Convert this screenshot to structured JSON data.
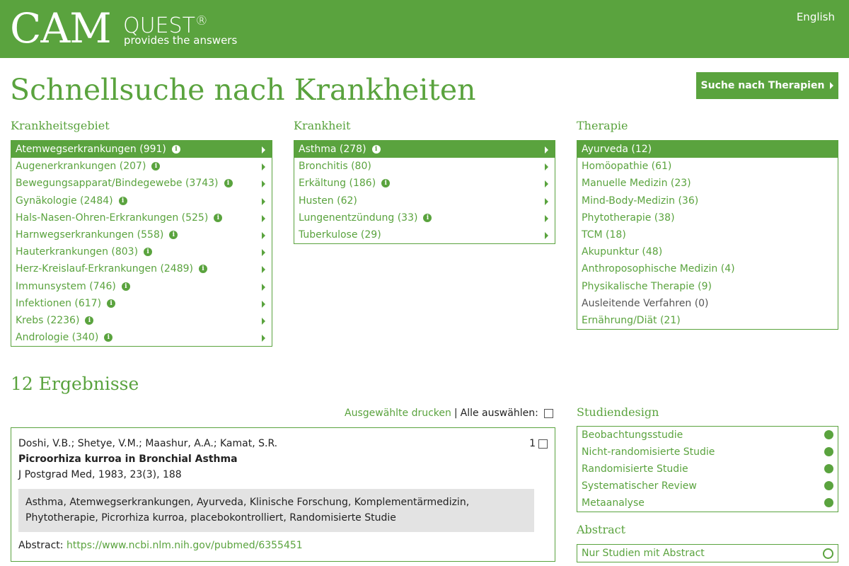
{
  "header": {
    "logo_cam": "CAM",
    "logo_quest": "QUEST",
    "logo_reg": "®",
    "tagline": "provides the answers",
    "language": "English"
  },
  "page_title": "Schnellsuche nach Krankheiten",
  "therapy_button": "Suche nach Therapien",
  "columns": {
    "krankheitsgebiet": {
      "title": "Krankheitsgebiet",
      "items": [
        {
          "label": "Atemwegserkrankungen (991)",
          "selected": true
        },
        {
          "label": "Augenerkrankungen (207)"
        },
        {
          "label": "Bewegungsapparat/Bindegewebe (3743)"
        },
        {
          "label": "Gynäkologie (2484)"
        },
        {
          "label": "Hals-Nasen-Ohren-Erkrankungen (525)"
        },
        {
          "label": "Harnwegserkrankungen (558)"
        },
        {
          "label": "Hauterkrankungen (803)"
        },
        {
          "label": "Herz-Kreislauf-Erkrankungen (2489)"
        },
        {
          "label": "Immunsystem (746)"
        },
        {
          "label": "Infektionen (617)"
        },
        {
          "label": "Krebs (2236)"
        },
        {
          "label": "Andrologie (340)"
        }
      ]
    },
    "krankheit": {
      "title": "Krankheit",
      "items": [
        {
          "label": "Asthma (278)",
          "selected": true,
          "info": true
        },
        {
          "label": "Bronchitis (80)",
          "info": false
        },
        {
          "label": "Erkältung (186)",
          "info": true
        },
        {
          "label": "Husten (62)",
          "info": false
        },
        {
          "label": "Lungenentzündung (33)",
          "info": true
        },
        {
          "label": "Tuberkulose (29)",
          "info": false
        }
      ]
    },
    "therapie": {
      "title": "Therapie",
      "items": [
        {
          "label": "Ayurveda (12)",
          "selected": true
        },
        {
          "label": "Homöopathie (61)"
        },
        {
          "label": "Manuelle Medizin (23)"
        },
        {
          "label": "Mind-Body-Medizin (36)"
        },
        {
          "label": "Phytotherapie (38)"
        },
        {
          "label": "TCM (18)"
        },
        {
          "label": "Akupunktur (48)"
        },
        {
          "label": "Anthroposophische Medizin (4)"
        },
        {
          "label": "Physikalische Therapie (9)"
        },
        {
          "label": "Ausleitende Verfahren (0)",
          "disabled": true
        },
        {
          "label": "Ernährung/Diät (21)"
        }
      ]
    }
  },
  "results": {
    "title": "12 Ergebnisse",
    "print_link": "Ausgewählte drucken",
    "separator": "|",
    "select_all": "Alle auswählen:",
    "items": [
      {
        "authors": "Doshi, V.B.; Shetye, V.M.; Maashur, A.A.; Kamat, S.R.",
        "title": "Picroorhiza kurroa in Bronchial Asthma",
        "journal": "J Postgrad Med, 1983, 23(3), 188",
        "number": "1",
        "tags": "Asthma, Atemwegserkrankungen, Ayurveda, Klinische Forschung, Komplementärmedizin, Phytotherapie, Picrorhiza kurroa, placebokontrolliert, Randomisierte Studie",
        "abstract_label": "Abstract:",
        "abstract_url": "https://www.ncbi.nlm.nih.gov/pubmed/6355451"
      }
    ]
  },
  "filters": {
    "studiendesign": {
      "title": "Studiendesign",
      "items": [
        "Beobachtungsstudie",
        "Nicht-randomisierte Studie",
        "Randomisierte Studie",
        "Systematischer Review",
        "Metaanalyse"
      ]
    },
    "abstract": {
      "title": "Abstract",
      "items": [
        "Nur Studien mit Abstract"
      ]
    }
  },
  "colors": {
    "brand_green": "#5aa33e",
    "tag_bg": "#e3e3e3"
  }
}
